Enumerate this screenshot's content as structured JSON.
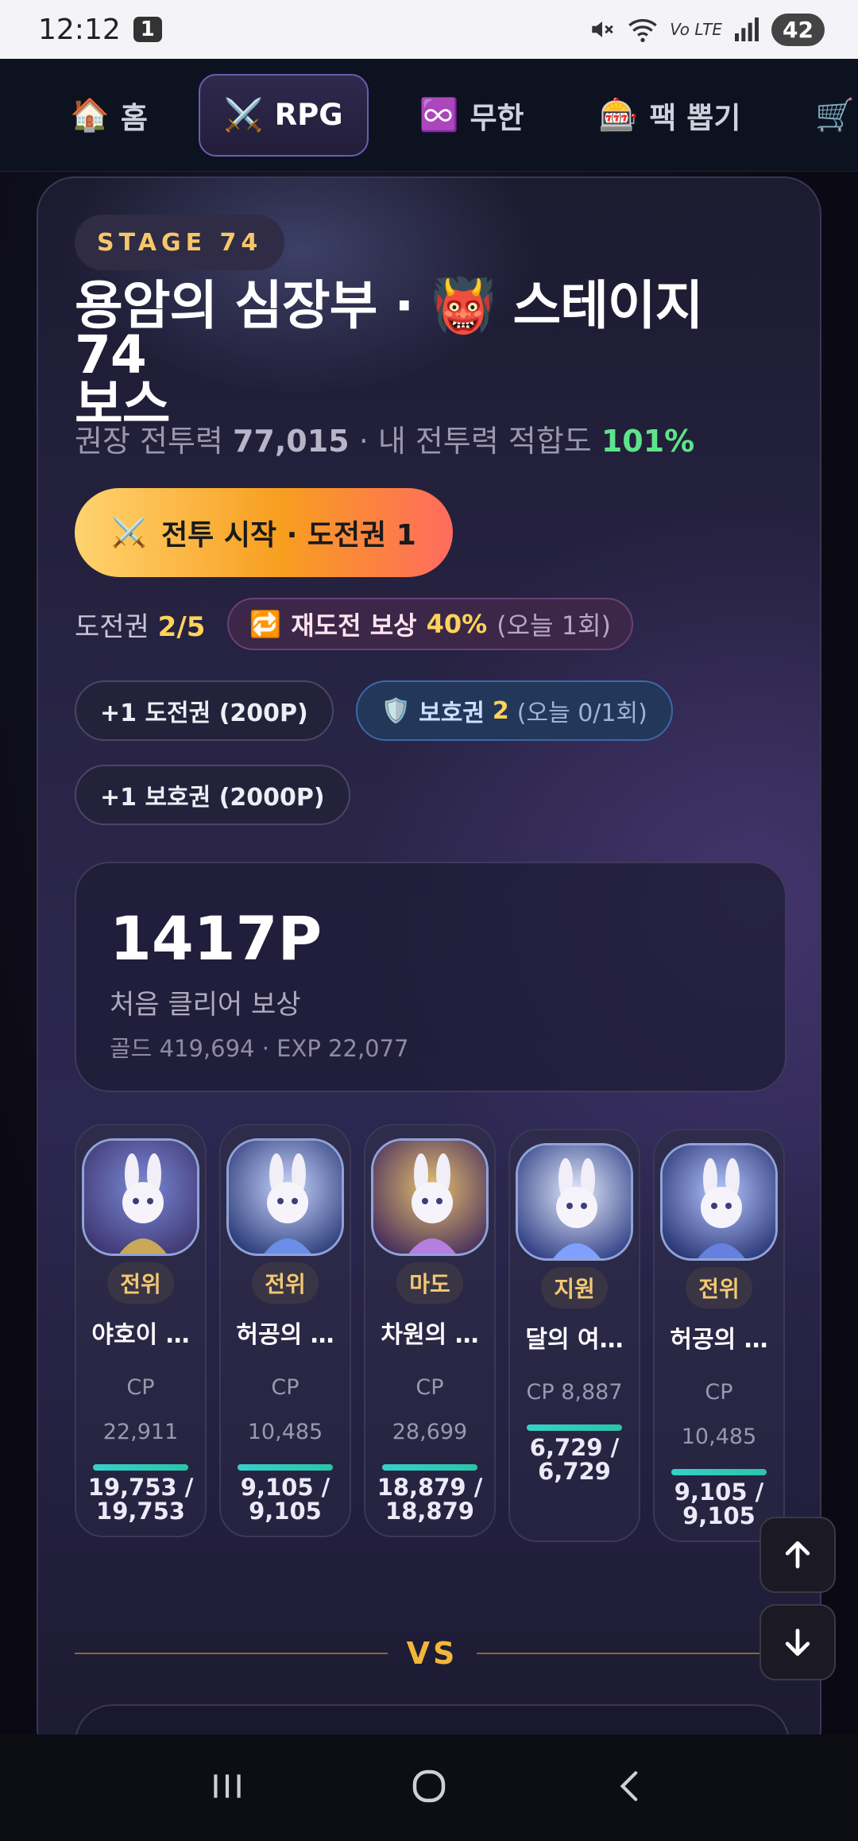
{
  "status_bar": {
    "time": "12:12",
    "notif_count": "1",
    "network": "Vo LTE",
    "battery": "42"
  },
  "nav": {
    "tabs": [
      {
        "icon": "🏠",
        "label": "홈"
      },
      {
        "icon": "⚔️",
        "label": "RPG"
      },
      {
        "icon": "♾️",
        "label": "무한"
      },
      {
        "icon": "🎰",
        "label": "팩 뽑기"
      },
      {
        "icon": "🛒",
        "label": ""
      }
    ],
    "active_tab": "RPG"
  },
  "stage": {
    "badge": "STAGE 74",
    "title_line1": "용암의 심장부 · 👹 스테이지 74",
    "title_line2": "보스",
    "recommend_label": "권장 전투력",
    "recommend_value": "77,015",
    "fit_label": "· 내 전투력 적합도",
    "fit_value": "101%"
  },
  "actions": {
    "start_icon": "⚔️",
    "start_label": "전투 시작 · 도전권 1",
    "tickets_label": "도전권",
    "tickets_value": "2/5",
    "retry_icon": "🔁",
    "retry_label": "재도전 보상",
    "retry_pct": "40%",
    "retry_note": "(오늘 1회)",
    "buy_ticket": "+1 도전권 (200P)",
    "shield_icon": "🛡️",
    "shield_label": "보호권",
    "shield_count": "2",
    "shield_note": "(오늘 0/1회)",
    "buy_shield": "+1 보호권 (2000P)"
  },
  "reward": {
    "points": "1417P",
    "label": "처음 클리어 보상",
    "detail": "골드 419,694 · EXP 22,077"
  },
  "party": [
    {
      "role": "전위",
      "name": "야호이 …",
      "cp_label": "CP",
      "cp": "22,911",
      "hp_line1": "19,753 /",
      "hp_line2": "19,753",
      "hp_fraction": 1.0
    },
    {
      "role": "전위",
      "name": "허공의 …",
      "cp_label": "CP",
      "cp": "10,485",
      "hp_line1": "9,105 /",
      "hp_line2": "9,105",
      "hp_fraction": 1.0
    },
    {
      "role": "마도",
      "name": "차원의 …",
      "cp_label": "CP",
      "cp": "28,699",
      "hp_line1": "18,879 /",
      "hp_line2": "18,879",
      "hp_fraction": 1.0
    },
    {
      "role": "지원",
      "name": "달의 여…",
      "cp_label": "CP 8,887",
      "cp": "",
      "hp_line1": "6,729 /",
      "hp_line2": "6,729",
      "hp_fraction": 1.0
    },
    {
      "role": "전위",
      "name": "허공의 …",
      "cp_label": "CP",
      "cp": "10,485",
      "hp_line1": "9,105 /",
      "hp_line2": "9,105",
      "hp_fraction": 1.0
    }
  ],
  "vs_label": "VS",
  "colors": {
    "accent_gold": "#f4b63a",
    "fit_green": "#5ee38a",
    "hp_bar": "#37d0c9",
    "active_tab_border": "#6c5bb0"
  }
}
